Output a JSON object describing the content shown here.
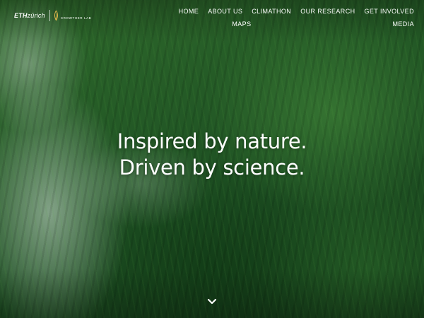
{
  "header": {
    "logo_eth_bold": "ETH",
    "logo_eth_italic": "zürich",
    "logo_crowther": "CROWTHER LAB",
    "nav": [
      {
        "label": "HOME"
      },
      {
        "label": "ABOUT US"
      },
      {
        "label": "CLIMATHON"
      },
      {
        "label": "OUR RESEARCH"
      },
      {
        "label": "GET INVOLVED"
      },
      {
        "label": "MAPS"
      },
      {
        "label": "MEDIA"
      }
    ]
  },
  "hero": {
    "line1": "Inspired by nature.",
    "line2": "Driven by science."
  },
  "icons": {
    "scroll": "chevron-down-icon",
    "crowther": "leaf-flame-icon"
  },
  "colors": {
    "text": "#ffffff",
    "forest": "#245a26"
  }
}
